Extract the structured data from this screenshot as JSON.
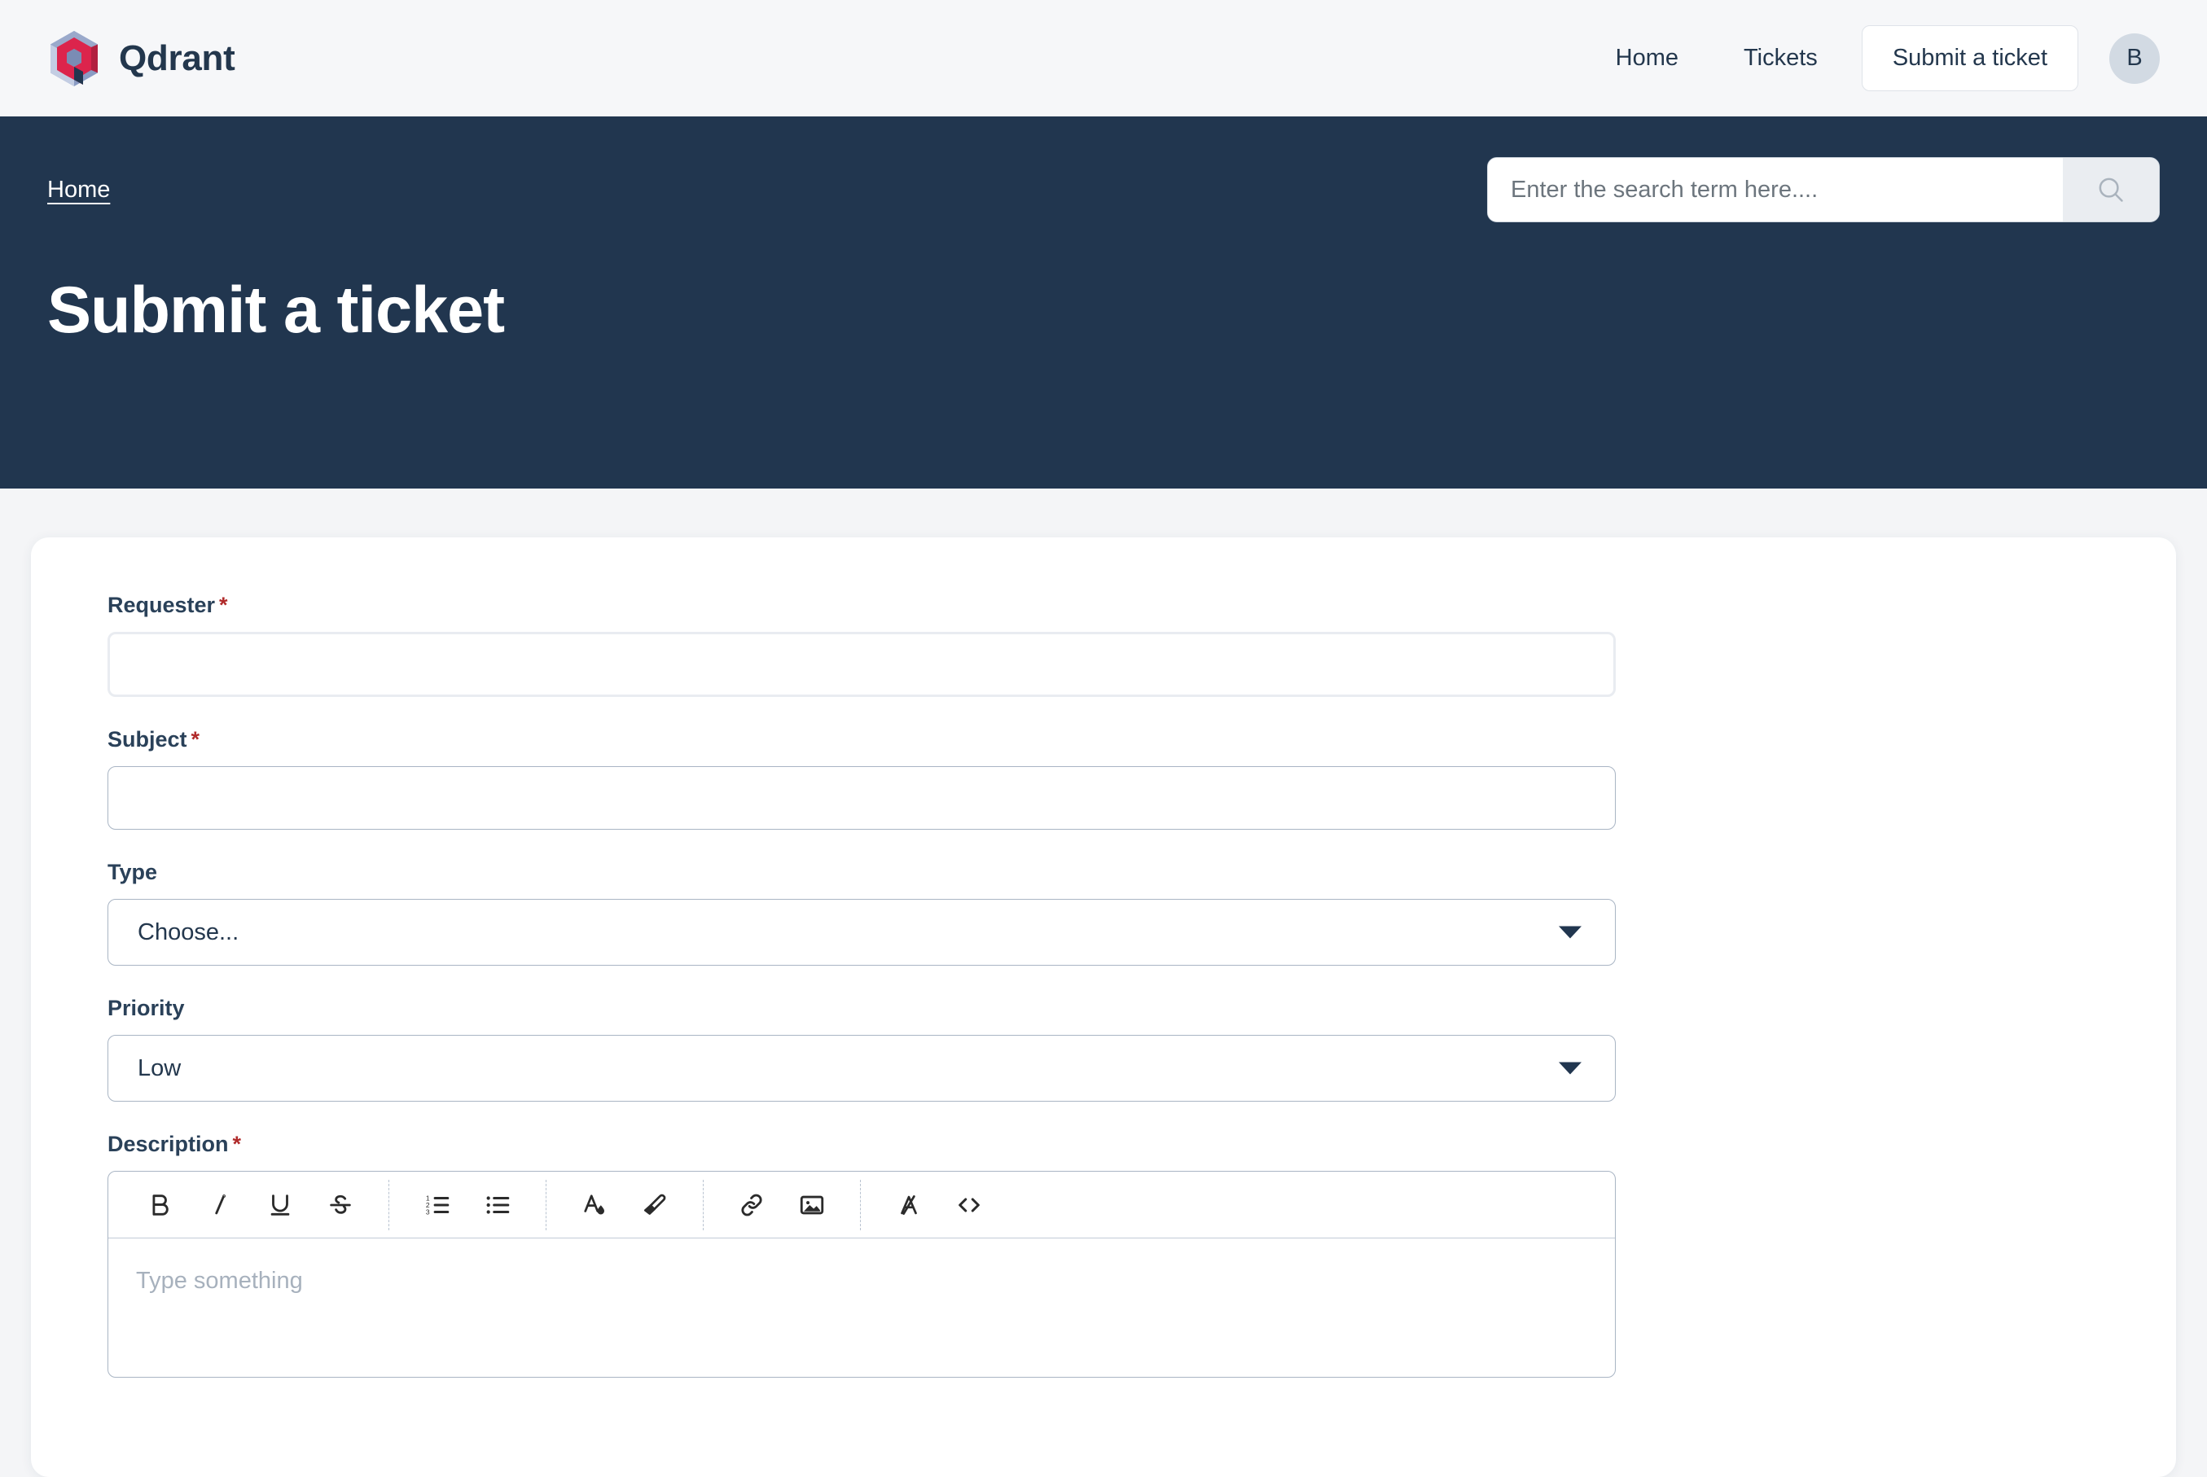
{
  "header": {
    "brand_name": "Qdrant",
    "brand_logo_icon": "qdrant-logo-icon",
    "nav": [
      {
        "label": "Home",
        "name": "nav-home"
      },
      {
        "label": "Tickets",
        "name": "nav-tickets"
      }
    ],
    "cta_label": "Submit a ticket",
    "avatar_initial": "B"
  },
  "hero": {
    "breadcrumb": "Home",
    "title": "Submit a ticket",
    "background_color": "#21364f",
    "search": {
      "placeholder": "Enter the search term here....",
      "value": "",
      "button_icon": "search-icon"
    }
  },
  "form": {
    "fields": {
      "requester": {
        "label": "Requester",
        "required_marker": "*",
        "value": "",
        "placeholder": ""
      },
      "subject": {
        "label": "Subject",
        "required_marker": "*",
        "value": "",
        "placeholder": ""
      },
      "type": {
        "label": "Type",
        "selected": "Choose...",
        "options": [
          "Choose..."
        ]
      },
      "priority": {
        "label": "Priority",
        "selected": "Low",
        "options": [
          "Low"
        ]
      },
      "description": {
        "label": "Description",
        "required_marker": "*",
        "placeholder": "Type something",
        "toolbar": [
          {
            "name": "bold-icon",
            "label": "B"
          },
          {
            "name": "italic-icon",
            "label": "i"
          },
          {
            "name": "underline-icon",
            "label": "U"
          },
          {
            "name": "strikethrough-icon",
            "label": "S"
          },
          {
            "name": "ordered-list-icon",
            "label": ""
          },
          {
            "name": "bullet-list-icon",
            "label": ""
          },
          {
            "name": "text-color-icon",
            "label": ""
          },
          {
            "name": "highlighter-icon",
            "label": ""
          },
          {
            "name": "link-icon",
            "label": ""
          },
          {
            "name": "image-icon",
            "label": ""
          },
          {
            "name": "clear-formatting-icon",
            "label": ""
          },
          {
            "name": "code-view-icon",
            "label": ""
          }
        ]
      }
    }
  },
  "colors": {
    "navy": "#21364f",
    "page_background": "#f4f5f7",
    "topbar_background": "#f6f7f9",
    "required_red": "#b02a2a",
    "label_navy": "#2a4159",
    "avatar_background": "#d2dae3",
    "input_border": "#a9b5c4",
    "requester_border": "#e9ecf1"
  }
}
